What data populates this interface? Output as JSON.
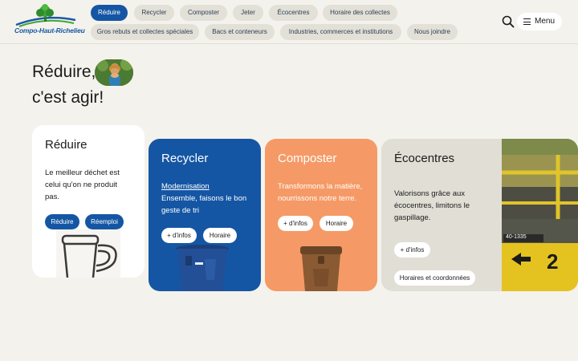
{
  "header": {
    "logo_text": "Compo-Haut-Richelieu",
    "nav_row1": [
      "Réduire",
      "Recycler",
      "Composter",
      "Jeter",
      "Écocentres",
      "Horaire des collectes"
    ],
    "nav_row2": [
      "Gros rebuts et collectes spéciales",
      "Bacs et conteneurs",
      "Industries, commerces et institutions",
      "Nous joindre"
    ],
    "menu_label": "Menu"
  },
  "hero": {
    "line1": "Réduire,",
    "line2": "c'est agir!"
  },
  "cards": {
    "reduire": {
      "title": "Réduire",
      "text": "Le meilleur déchet est celui qu'on ne produit pas.",
      "btn1": "Réduire",
      "btn2": "Réemploi"
    },
    "recycler": {
      "title": "Recycler",
      "link": "Modernisation",
      "text": "Ensemble, faisons le bon geste de tri",
      "btn1": "+ d'infos",
      "btn2": "Horaire"
    },
    "composter": {
      "title": "Composter",
      "text": "Transformons la matière, nourrissons notre terre.",
      "btn1": "+ d'infos",
      "btn2": "Horaire"
    },
    "ecocentres": {
      "title": "Écocentres",
      "text": "Valorisons grâce aux écocentres, limitons le gaspillage.",
      "btn1": "+ d'infos",
      "btn2": "Horaires et coordonnées"
    }
  },
  "photo_signs": {
    "number": "2",
    "label": "40-1335"
  },
  "colors": {
    "accent_blue": "#1556a4",
    "orange": "#f59a66",
    "background": "#f4f2ec",
    "pill": "#e2e0d7"
  }
}
